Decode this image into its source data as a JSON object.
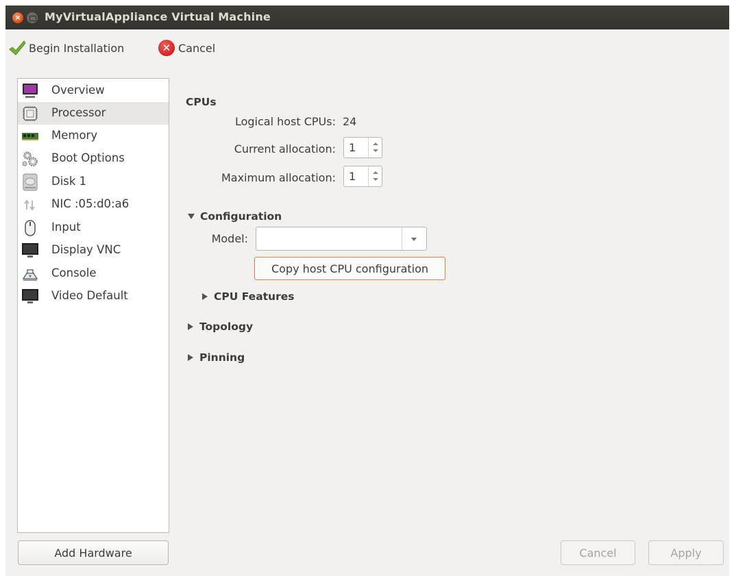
{
  "window": {
    "title": "MyVirtualAppliance Virtual Machine"
  },
  "toolbar": {
    "begin_label": "Begin Installation",
    "cancel_label": "Cancel"
  },
  "sidebar": {
    "items": [
      {
        "label": "Overview",
        "icon": "monitor-icon"
      },
      {
        "label": "Processor",
        "icon": "cpu-chip-icon"
      },
      {
        "label": "Memory",
        "icon": "memory-icon"
      },
      {
        "label": "Boot Options",
        "icon": "gears-icon"
      },
      {
        "label": "Disk 1",
        "icon": "disk-icon"
      },
      {
        "label": "NIC :05:d0:a6",
        "icon": "network-icon"
      },
      {
        "label": "Input",
        "icon": "mouse-icon"
      },
      {
        "label": "Display VNC",
        "icon": "display-icon"
      },
      {
        "label": "Console",
        "icon": "console-icon"
      },
      {
        "label": "Video Default",
        "icon": "video-icon"
      }
    ],
    "selected": "Processor",
    "add_hardware_label": "Add Hardware"
  },
  "cpus": {
    "title": "CPUs",
    "logical_label": "Logical host CPUs:",
    "logical_value": "24",
    "current_label": "Current allocation:",
    "current_value": "1",
    "maximum_label": "Maximum allocation:",
    "maximum_value": "1"
  },
  "configuration": {
    "title": "Configuration",
    "model_label": "Model:",
    "model_value": "",
    "copy_host_label": "Copy host CPU configuration",
    "cpu_features_label": "CPU Features"
  },
  "topology_label": "Topology",
  "pinning_label": "Pinning",
  "buttons": {
    "cancel_label": "Cancel",
    "apply_label": "Apply"
  },
  "colors": {
    "titlebar": "#3c3b37",
    "close_button": "#e4531d",
    "focus_border": "#e9784d",
    "selected_row": "#e8e6e3"
  }
}
